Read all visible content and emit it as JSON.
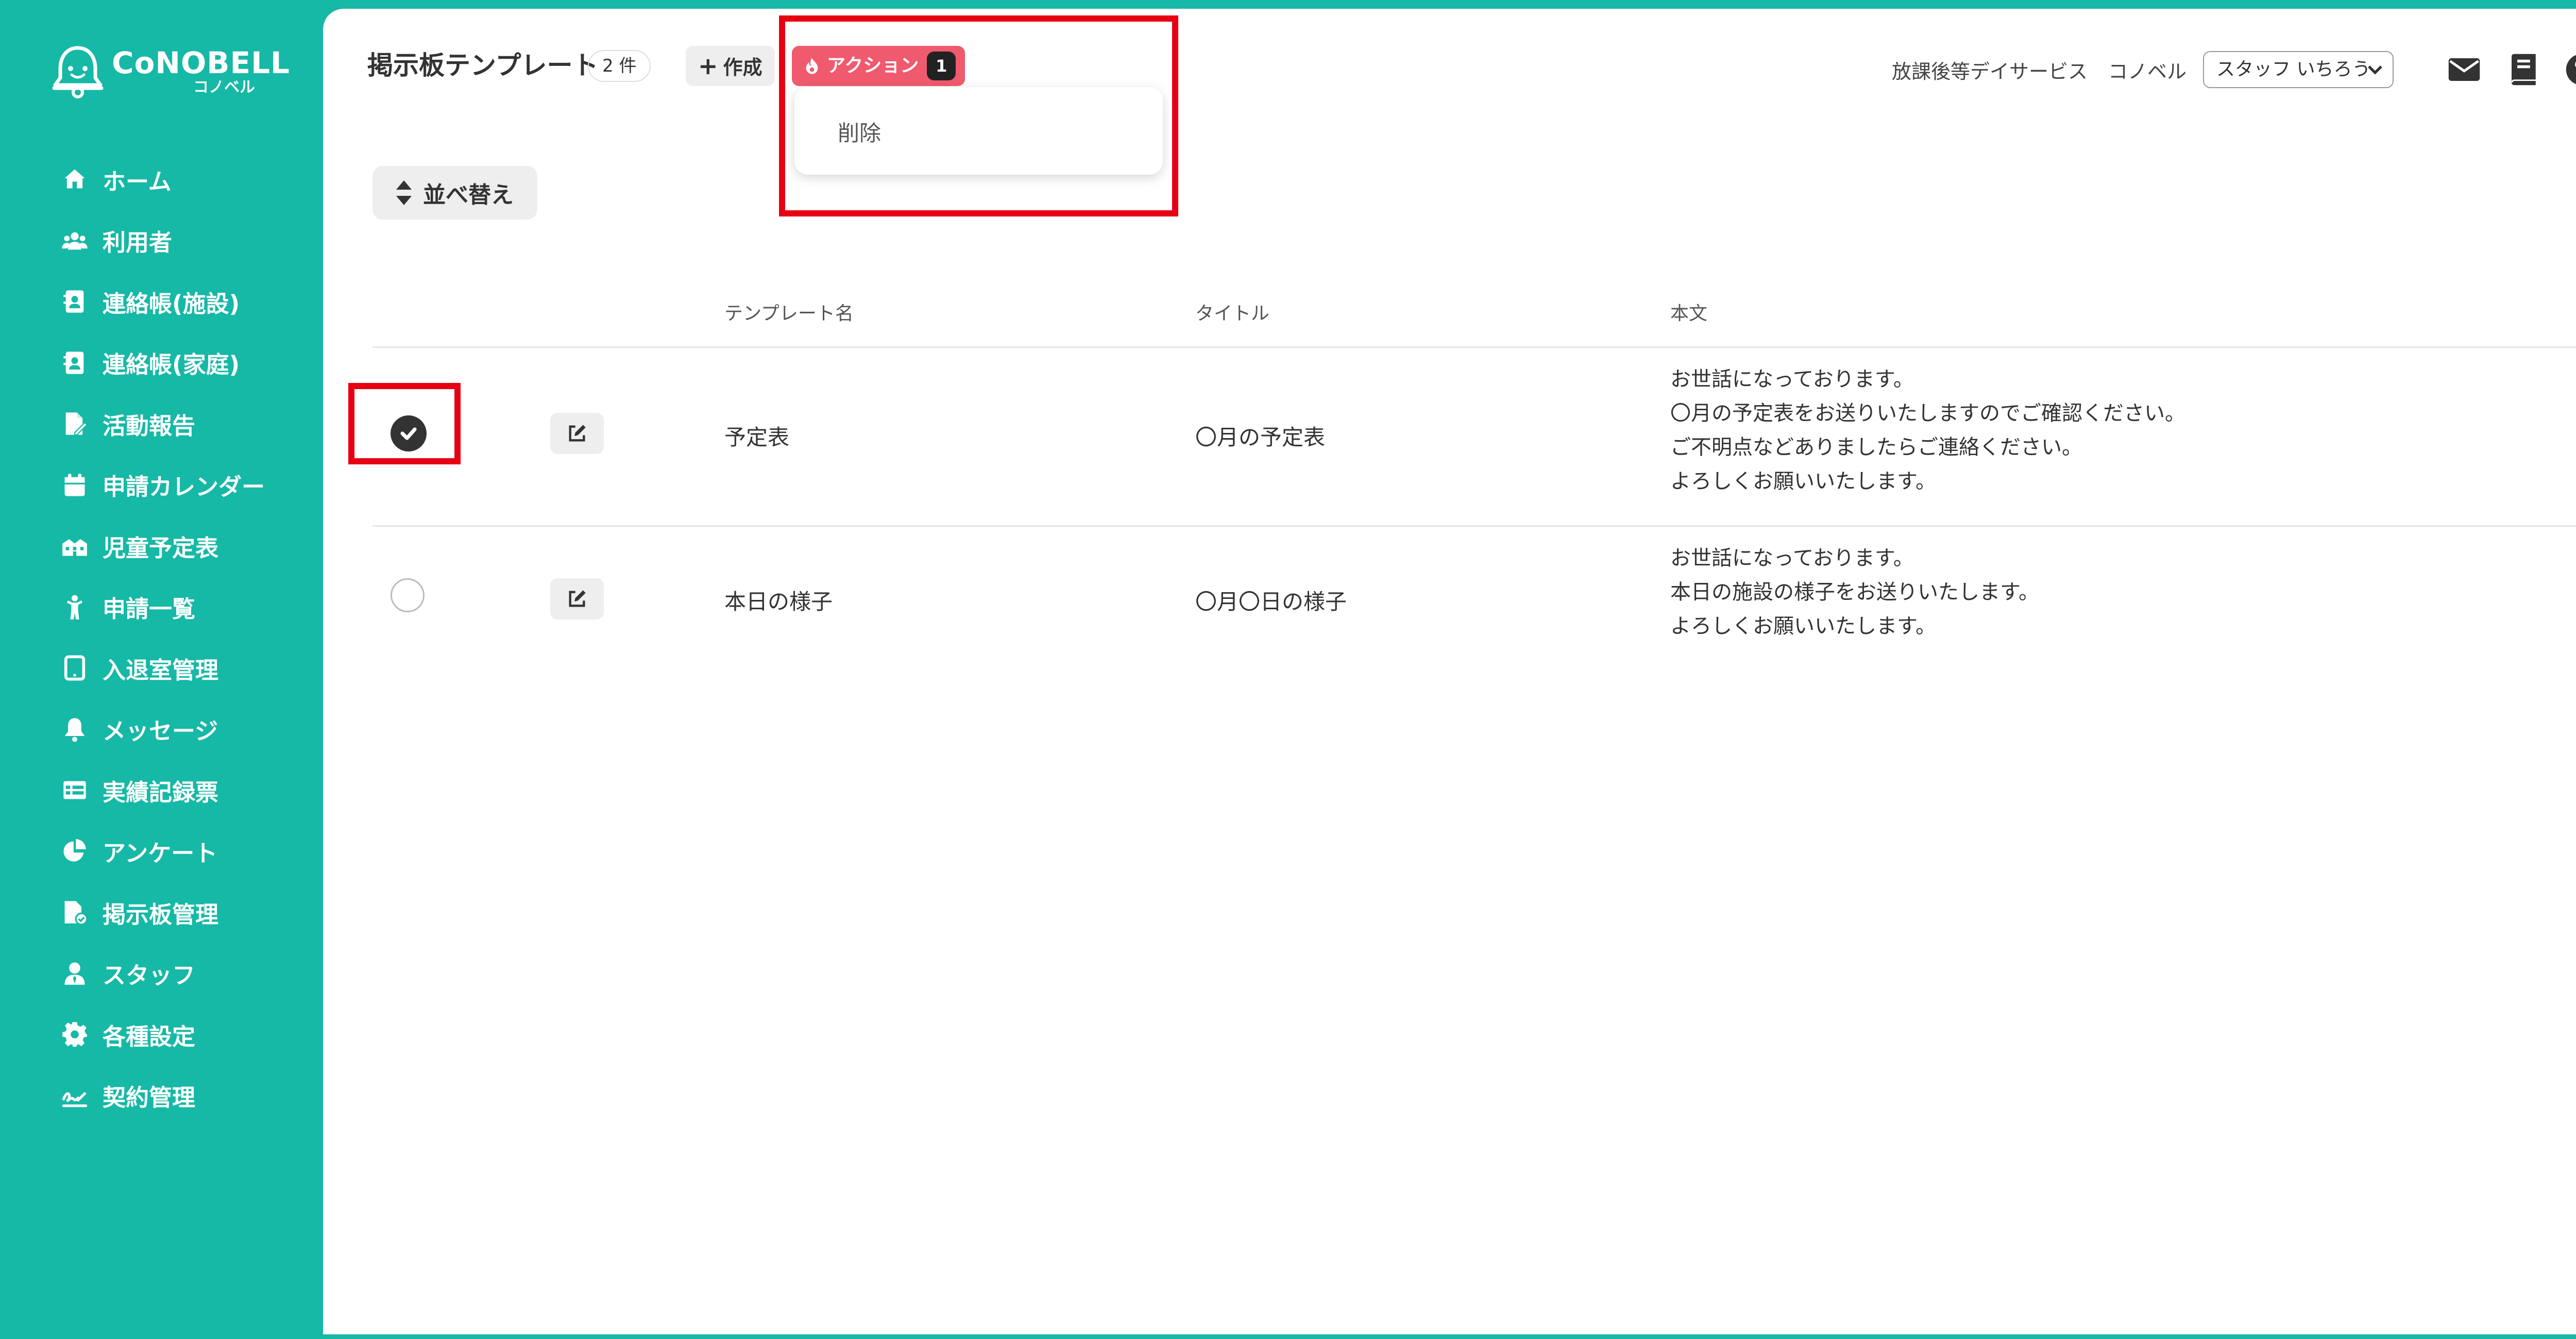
{
  "brand": {
    "name": "CoNOBELL",
    "sub": "コノベル",
    "color": "#16b8a6"
  },
  "sidebar": {
    "items": [
      {
        "label": "ホーム",
        "icon": "home-icon"
      },
      {
        "label": "利用者",
        "icon": "users-icon"
      },
      {
        "label": "連絡帳(施設)",
        "icon": "contact-book-icon"
      },
      {
        "label": "連絡帳(家庭)",
        "icon": "contact-book-icon"
      },
      {
        "label": "活動報告",
        "icon": "report-icon"
      },
      {
        "label": "申請カレンダー",
        "icon": "calendar-icon"
      },
      {
        "label": "児童予定表",
        "icon": "schedule-icon"
      },
      {
        "label": "申請一覧",
        "icon": "child-icon"
      },
      {
        "label": "入退室管理",
        "icon": "tablet-icon"
      },
      {
        "label": "メッセージ",
        "icon": "bell-icon"
      },
      {
        "label": "実績記録票",
        "icon": "table-icon"
      },
      {
        "label": "アンケート",
        "icon": "pie-chart-icon"
      },
      {
        "label": "掲示板管理",
        "icon": "board-icon"
      },
      {
        "label": "スタッフ",
        "icon": "staff-icon"
      },
      {
        "label": "各種設定",
        "icon": "gear-icon"
      },
      {
        "label": "契約管理",
        "icon": "contract-icon"
      }
    ]
  },
  "header": {
    "title": "掲示板テンプレート",
    "count": "2 件",
    "create_label": "作成",
    "action_label": "アクション",
    "action_count": "1",
    "action_color": "#ef5a6e",
    "facility": "放課後等デイサービス",
    "company": "コノベル",
    "staff": "スタッフ いちろう"
  },
  "dropdown": {
    "items": [
      "削除"
    ]
  },
  "sort": {
    "label": "並べ替え"
  },
  "table": {
    "columns": [
      "テンプレート名",
      "タイトル",
      "本文"
    ],
    "rows": [
      {
        "checked": true,
        "name": "予定表",
        "title": "〇月の予定表",
        "body": [
          "お世話になっております。",
          "〇月の予定表をお送りいたしますのでご確認ください。",
          "ご不明点などありましたらご連絡ください。",
          "よろしくお願いいたします。"
        ]
      },
      {
        "checked": false,
        "name": "本日の様子",
        "title": "〇月〇日の様子",
        "body": [
          "お世話になっております。",
          "本日の施設の様子をお送りいたします。",
          "よろしくお願いいたします。"
        ]
      }
    ]
  },
  "highlight_color": "#e60012"
}
